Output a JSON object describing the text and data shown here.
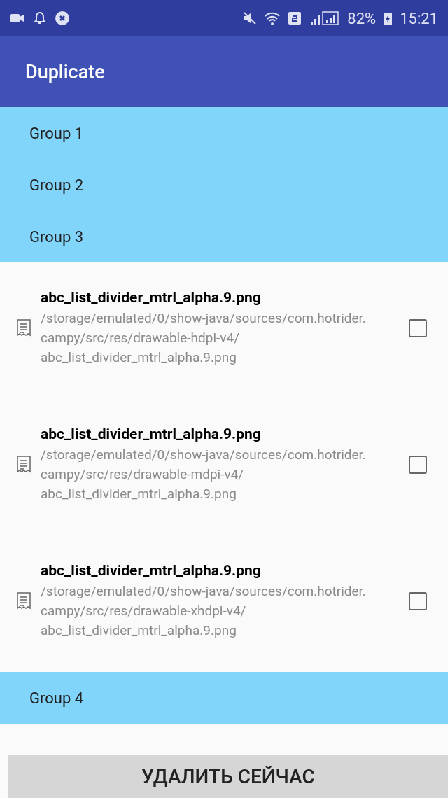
{
  "status_bar": {
    "battery": "82%",
    "time": "15:21"
  },
  "app_bar": {
    "title": "Duplicate"
  },
  "groups": [
    {
      "title": "Group 1"
    },
    {
      "title": "Group 2"
    },
    {
      "title": "Group 3",
      "files": [
        {
          "name": "abc_list_divider_mtrl_alpha.9.png",
          "path": "/storage/emulated/0/show-java/sources/com.hotrider.campy/src/res/drawable-hdpi-v4/abc_list_divider_mtrl_alpha.9.png",
          "checked": false
        },
        {
          "name": "abc_list_divider_mtrl_alpha.9.png",
          "path": "/storage/emulated/0/show-java/sources/com.hotrider.campy/src/res/drawable-mdpi-v4/abc_list_divider_mtrl_alpha.9.png",
          "checked": false
        },
        {
          "name": "abc_list_divider_mtrl_alpha.9.png",
          "path": "/storage/emulated/0/show-java/sources/com.hotrider.campy/src/res/drawable-xhdpi-v4/abc_list_divider_mtrl_alpha.9.png",
          "checked": false
        }
      ]
    },
    {
      "title": "Group 4"
    }
  ],
  "action_button": "УДАЛИТЬ СЕЙЧАС"
}
